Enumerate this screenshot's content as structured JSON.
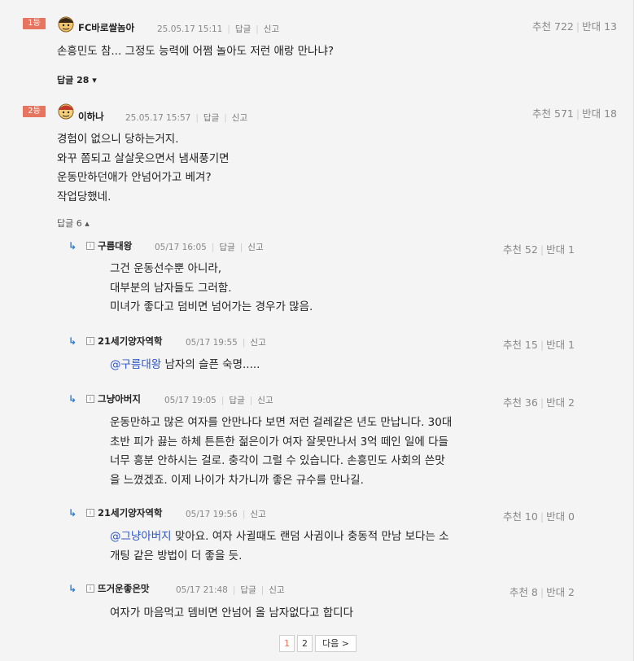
{
  "comments": [
    {
      "rank": "1등",
      "nickname": "FC바로쌀놈아",
      "datetime": "25.05.17 15:11",
      "reply_label": "답글",
      "report_label": "신고",
      "upvote": "추천 722",
      "downvote": "반대 13",
      "lines": [
        "손흥민도 참... 그정도 능력에 어쩜 놀아도 저런 애랑 만나냐?"
      ],
      "reply_toggle": "답글 28 ▾"
    },
    {
      "rank": "2등",
      "nickname": "이하나",
      "datetime": "25.05.17 15:57",
      "reply_label": "답글",
      "report_label": "신고",
      "upvote": "추천 571",
      "downvote": "반대 18",
      "lines": [
        "경험이 없으니 당하는거지.",
        "와꾸 쫌되고 살살웃으면서 냄새풍기면",
        "운동만하던애가 안넘어가고 베겨?",
        "작업당했네."
      ],
      "reply_toggle": "답글 6 ▴"
    }
  ],
  "replies": [
    {
      "nickname": "구름대왕",
      "datetime": "05/17 16:05",
      "reply_label": "답글",
      "report_label": "신고",
      "upvote": "추천 52",
      "downvote": "반대 1",
      "mention": "",
      "lines": [
        "그건 운동선수뿐 아니라,",
        "대부분의 남자들도 그러함.",
        "미녀가 좋다고 덤비면 넘어가는 경우가 많음."
      ]
    },
    {
      "nickname": "21세기양자역학",
      "datetime": "05/17 19:55",
      "reply_label": "",
      "report_label": "신고",
      "upvote": "추천 15",
      "downvote": "반대 1",
      "mention": "@구름대왕",
      "lines": [
        " 남자의 슬픈 숙명....."
      ]
    },
    {
      "nickname": "그냥아버지",
      "datetime": "05/17 19:05",
      "reply_label": "답글",
      "report_label": "신고",
      "upvote": "추천 36",
      "downvote": "반대 2",
      "mention": "",
      "lines": [
        "운동만하고 많은 여자를 안만나다 보면 저런 걸레같은 년도 만납니다. 30대",
        "초반 피가 끓는 하체 튼튼한 젊은이가 여자 잘못만나서 3억 떼인 일에 다들",
        "너무 흥분 안하시는 걸로. 충각이 그럴 수 있습니다. 손흥민도 사회의 쓴맛",
        "을 느꼈겠죠. 이제 나이가 차가니까 좋은 규수를 만나길."
      ]
    },
    {
      "nickname": "21세기양자역학",
      "datetime": "05/17 19:56",
      "reply_label": "",
      "report_label": "신고",
      "upvote": "추천 10",
      "downvote": "반대 0",
      "mention": "@그냥아버지",
      "lines": [
        " 맞아요. 여자 사귈때도 랜덤 사귐이나 충동적 만남 보다는 소",
        "개팅 같은 방법이 더 좋을 듯."
      ]
    },
    {
      "nickname": "뜨거운좋은맛",
      "datetime": "05/17 21:48",
      "reply_label": "답글",
      "report_label": "신고",
      "upvote": "추천 8",
      "downvote": "반대 2",
      "mention": "",
      "lines": [
        "여자가 마음먹고 뎀비면 안넘어 올 남자없다고 합디다"
      ]
    }
  ],
  "pagination": {
    "pages": [
      "1",
      "2"
    ],
    "active": "1",
    "next_label": "다음 >"
  },
  "colors": {
    "rank_badge": "#e7745e",
    "mention": "#2e56c6",
    "reply_arrow": "#2e7dd1"
  },
  "icons": {
    "reply_arrow": "↳",
    "level_icon": "ⅰ"
  }
}
